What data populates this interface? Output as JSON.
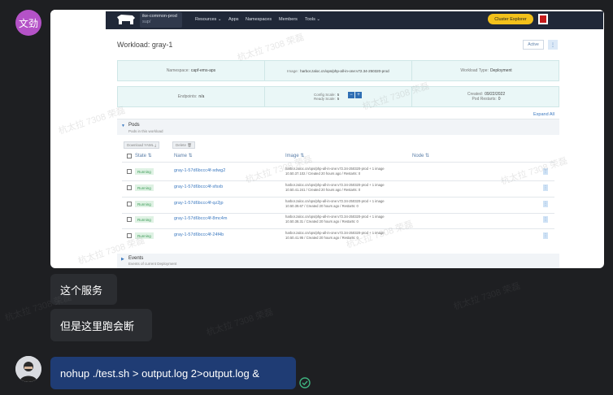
{
  "sender1": {
    "avatar_text": "文劲"
  },
  "messages": [
    {
      "text": "这个服务"
    },
    {
      "text": "但是这里跑会断"
    },
    {
      "text": "nohup ./test.sh > output.log 2>output.log &"
    }
  ],
  "watermark": "杭太拉 7308 荣磊",
  "screenshot": {
    "nav": {
      "context_name": "ike-common-prod",
      "context_sub": "sup/",
      "items": [
        "Resources ⌄",
        "Apps",
        "Namespaces",
        "Members",
        "Tools ⌄"
      ],
      "cluster_explorer": "Cluster Explorer"
    },
    "title": "Workload: gray-1",
    "state_badge": "Active",
    "info1": {
      "namespace_label": "Namespace:",
      "namespace_value": "capf-ems-aps",
      "image_label": "Image:",
      "image_value": "harbor.zaloc.cn/ops/php-all-in-one:v72.34-250320-prod",
      "type_label": "Workload Type:",
      "type_value": "Deployment"
    },
    "info2": {
      "endpoints_label": "Endpoints:",
      "endpoints_value": "n/a",
      "config_scale_label": "Config Scale:",
      "config_scale_value": "5",
      "ready_scale_label": "Ready Scale:",
      "ready_scale_value": "5",
      "created_label": "Created:",
      "created_value": "09/22/2022",
      "restarts_label": "Pod Restarts:",
      "restarts_value": "0"
    },
    "expand_all": "Expand All",
    "pods": {
      "title": "Pods",
      "subtitle": "Pods in this workload"
    },
    "toolbar": {
      "download": "Download YAML ⤓",
      "delete": "Delete 🗑"
    },
    "columns": [
      "State ⇅",
      "Name ⇅",
      "Image ⇅",
      "Node ⇅"
    ],
    "rows": [
      {
        "state": "Running",
        "name": "gray-1-57d6bccc4f-sdwg2",
        "image": "harbor.zaloc.cn/ops/php-all-in-one:v72.34-250320-prod + 1 image",
        "meta": "10.50.37.102 / Created 20 hours ago / Restarts: 0"
      },
      {
        "state": "Running",
        "name": "gray-1-57d6bccc4f-sfsxb",
        "image": "harbor.zaloc.cn/ops/php-all-in-one:v72.34-250320-prod + 1 image",
        "meta": "10.50.41.241 / Created 20 hours ago / Restarts: 0"
      },
      {
        "state": "Running",
        "name": "gray-1-57d6bccc4f-qz2jp",
        "image": "harbor.zaloc.cn/ops/php-all-in-one:v72.34-250320-prod + 1 image",
        "meta": "10.50.39.67 / Created 20 hours ago / Restarts: 0"
      },
      {
        "state": "Running",
        "name": "gray-1-57d6bccc4f-8mc4m",
        "image": "harbor.zaloc.cn/ops/php-all-in-one:v72.34-250320-prod + 1 image",
        "meta": "10.50.38.31 / Created 20 hours ago / Restarts: 0"
      },
      {
        "state": "Running",
        "name": "gray-1-57d6bccc4f-24f4b",
        "image": "harbor.zaloc.cn/ops/php-all-in-one:v72.34-250320-prod + 1 image",
        "meta": "10.50.41.95 / Created 20 hours ago / Restarts: 0"
      }
    ],
    "events": {
      "title": "Events",
      "subtitle": "Events of current Deployment"
    }
  },
  "colors": {
    "page_bg": "#1e1f22",
    "bubble_bg": "#2b2d31",
    "own_bubble_bg": "#1f3c74",
    "nav_bg": "#202838",
    "accent": "#f3c11b"
  }
}
